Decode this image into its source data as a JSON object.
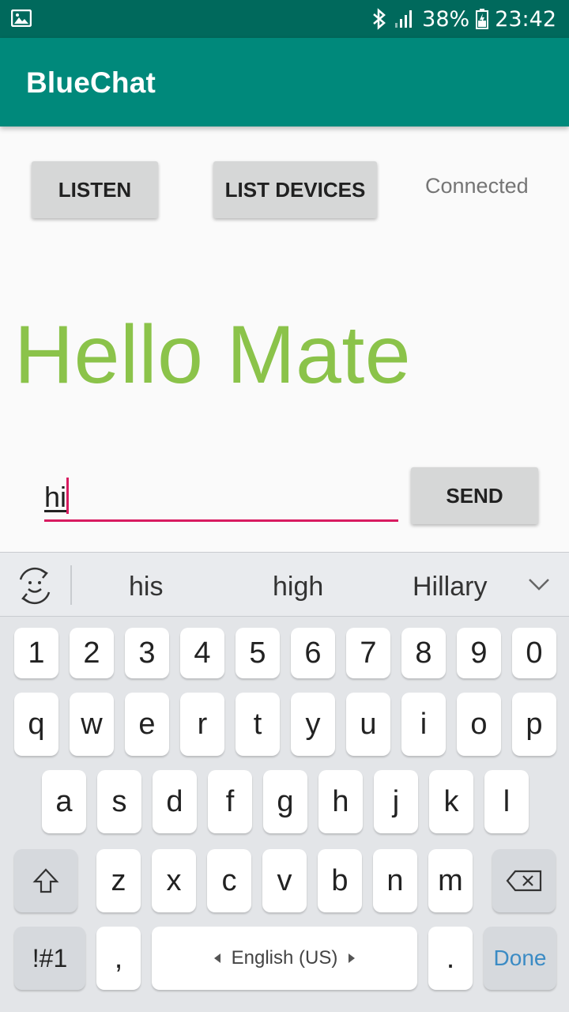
{
  "status_bar": {
    "battery": "38%",
    "time": "23:42",
    "icons": [
      "image-icon",
      "bluetooth-icon",
      "signal-icon",
      "battery-icon"
    ]
  },
  "app_bar": {
    "title": "BlueChat"
  },
  "controls": {
    "listen_label": "LISTEN",
    "list_devices_label": "LIST DEVICES",
    "status_text": "Connected"
  },
  "message": {
    "text": "Hello Mate"
  },
  "compose": {
    "input_value": "hi",
    "send_label": "SEND"
  },
  "keyboard": {
    "suggestions": [
      "his",
      "high",
      "Hillary"
    ],
    "row_numbers": [
      "1",
      "2",
      "3",
      "4",
      "5",
      "6",
      "7",
      "8",
      "9",
      "0"
    ],
    "row_q": [
      "q",
      "w",
      "e",
      "r",
      "t",
      "y",
      "u",
      "i",
      "o",
      "p"
    ],
    "row_a": [
      "a",
      "s",
      "d",
      "f",
      "g",
      "h",
      "j",
      "k",
      "l"
    ],
    "row_z": [
      "z",
      "x",
      "c",
      "v",
      "b",
      "n",
      "m"
    ],
    "symbols_label": "!#1",
    "comma_label": ",",
    "space_label": "English (US)",
    "period_label": ".",
    "done_label": "Done"
  },
  "colors": {
    "status_bar": "#00695c",
    "app_bar": "#00897b",
    "message": "#8bc34a",
    "accent": "#d81b60",
    "done": "#3b8bc4"
  }
}
